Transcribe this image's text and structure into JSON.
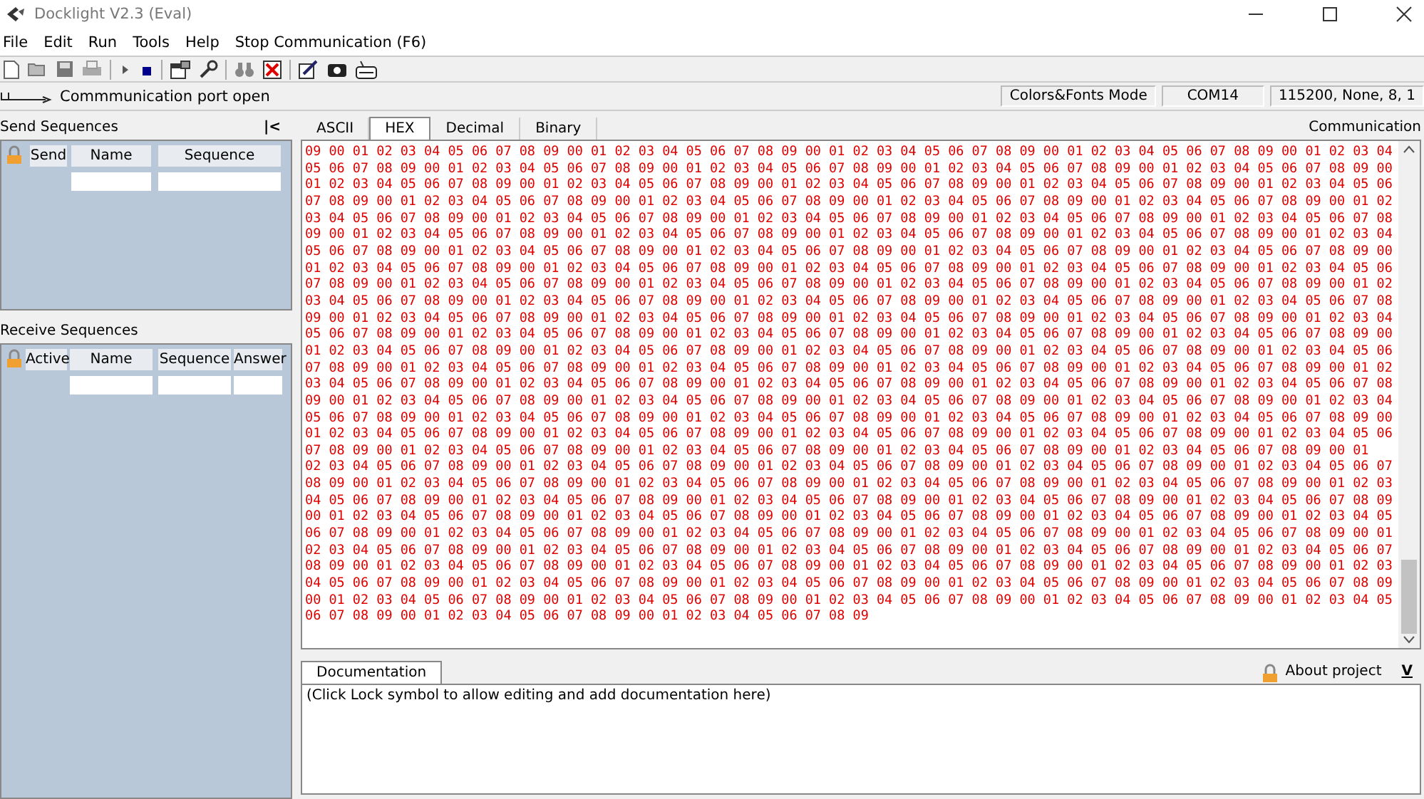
{
  "window": {
    "title": "Docklight V2.3 (Eval)"
  },
  "menu": [
    "File",
    "Edit",
    "Run",
    "Tools",
    "Help",
    "Stop Communication  (F6)"
  ],
  "status": {
    "port_message": "Commmunication port open",
    "mode": "Colors&Fonts Mode",
    "port": "COM14",
    "settings": "115200, None, 8, 1"
  },
  "send_sequences": {
    "title": "Send Sequences",
    "collapse": "|<",
    "columns": [
      "Send",
      "Name",
      "Sequence"
    ]
  },
  "receive_sequences": {
    "title": "Receive Sequences",
    "columns": [
      "Active",
      "Name",
      "Sequence",
      "Answer"
    ]
  },
  "communication": {
    "title": "Communication",
    "tabs": [
      {
        "label": "ASCII",
        "selected": false
      },
      {
        "label": "HEX",
        "selected": true
      },
      {
        "label": "Decimal",
        "selected": false
      },
      {
        "label": "Binary",
        "selected": false
      }
    ],
    "lines": [
      "09 00 01 02 03 04 05 06 07 08 09 00 01 02 03 04 05 06 07 08 09 00 01 02 03 04 05 06 07 08 09 00 01 02 03 04 05 06 07 08 09 00 01 02 03 04",
      "05 06 07 08 09 00 01 02 03 04 05 06 07 08 09 00 01 02 03 04 05 06 07 08 09 00 01 02 03 04 05 06 07 08 09 00 01 02 03 04 05 06 07 08 09 00",
      "01 02 03 04 05 06 07 08 09 00 01 02 03 04 05 06 07 08 09 00 01 02 03 04 05 06 07 08 09 00 01 02 03 04 05 06 07 08 09 00 01 02 03 04 05 06",
      "07 08 09 00 01 02 03 04 05 06 07 08 09 00 01 02 03 04 05 06 07 08 09 00 01 02 03 04 05 06 07 08 09 00 01 02 03 04 05 06 07 08 09 00 01 02",
      "03 04 05 06 07 08 09 00 01 02 03 04 05 06 07 08 09 00 01 02 03 04 05 06 07 08 09 00 01 02 03 04 05 06 07 08 09 00 01 02 03 04 05 06 07 08",
      "09 00 01 02 03 04 05 06 07 08 09 00 01 02 03 04 05 06 07 08 09 00 01 02 03 04 05 06 07 08 09 00 01 02 03 04 05 06 07 08 09 00 01 02 03 04",
      "05 06 07 08 09 00 01 02 03 04 05 06 07 08 09 00 01 02 03 04 05 06 07 08 09 00 01 02 03 04 05 06 07 08 09 00 01 02 03 04 05 06 07 08 09 00",
      "01 02 03 04 05 06 07 08 09 00 01 02 03 04 05 06 07 08 09 00 01 02 03 04 05 06 07 08 09 00 01 02 03 04 05 06 07 08 09 00 01 02 03 04 05 06",
      "07 08 09 00 01 02 03 04 05 06 07 08 09 00 01 02 03 04 05 06 07 08 09 00 01 02 03 04 05 06 07 08 09 00 01 02 03 04 05 06 07 08 09 00 01 02",
      "03 04 05 06 07 08 09 00 01 02 03 04 05 06 07 08 09 00 01 02 03 04 05 06 07 08 09 00 01 02 03 04 05 06 07 08 09 00 01 02 03 04 05 06 07 08",
      "09 00 01 02 03 04 05 06 07 08 09 00 01 02 03 04 05 06 07 08 09 00 01 02 03 04 05 06 07 08 09 00 01 02 03 04 05 06 07 08 09 00 01 02 03 04",
      "05 06 07 08 09 00 01 02 03 04 05 06 07 08 09 00 01 02 03 04 05 06 07 08 09 00 01 02 03 04 05 06 07 08 09 00 01 02 03 04 05 06 07 08 09 00",
      "01 02 03 04 05 06 07 08 09 00 01 02 03 04 05 06 07 08 09 00 01 02 03 04 05 06 07 08 09 00 01 02 03 04 05 06 07 08 09 00 01 02 03 04 05 06",
      "07 08 09 00 01 02 03 04 05 06 07 08 09 00 01 02 03 04 05 06 07 08 09 00 01 02 03 04 05 06 07 08 09 00 01 02 03 04 05 06 07 08 09 00 01 02",
      "03 04 05 06 07 08 09 00 01 02 03 04 05 06 07 08 09 00 01 02 03 04 05 06 07 08 09 00 01 02 03 04 05 06 07 08 09 00 01 02 03 04 05 06 07 08",
      "09 00 01 02 03 04 05 06 07 08 09 00 01 02 03 04 05 06 07 08 09 00 01 02 03 04 05 06 07 08 09 00 01 02 03 04 05 06 07 08 09 00 01 02 03 04",
      "05 06 07 08 09 00 01 02 03 04 05 06 07 08 09 00 01 02 03 04 05 06 07 08 09 00 01 02 03 04 05 06 07 08 09 00 01 02 03 04 05 06 07 08 09 00",
      "01 02 03 04 05 06 07 08 09 00 01 02 03 04 05 06 07 08 09 00 01 02 03 04 05 06 07 08 09 00 01 02 03 04 05 06 07 08 09 00 01 02 03 04 05 06",
      "07 08 09 00 01 02 03 04 05 06 07 08 09 00 01 02 03 04 05 06 07 08 09 00 01 02 03 04 05 06 07 08 09 00 01 02 03 04 05 06 07 08 09 00 01",
      "02 03 04 05 06 07 08 09 00 01 02 03 04 05 06 07 08 09 00 01 02 03 04 05 06 07 08 09 00 01 02 03 04 05 06 07 08 09 00 01 02 03 04 05 06 07",
      "08 09 00 01 02 03 04 05 06 07 08 09 00 01 02 03 04 05 06 07 08 09 00 01 02 03 04 05 06 07 08 09 00 01 02 03 04 05 06 07 08 09 00 01 02 03",
      "04 05 06 07 08 09 00 01 02 03 04 05 06 07 08 09 00 01 02 03 04 05 06 07 08 09 00 01 02 03 04 05 06 07 08 09 00 01 02 03 04 05 06 07 08 09",
      "00 01 02 03 04 05 06 07 08 09 00 01 02 03 04 05 06 07 08 09 00 01 02 03 04 05 06 07 08 09 00 01 02 03 04 05 06 07 08 09 00 01 02 03 04 05",
      "06 07 08 09 00 01 02 03 04 05 06 07 08 09 00 01 02 03 04 05 06 07 08 09 00 01 02 03 04 05 06 07 08 09 00 01 02 03 04 05 06 07 08 09 00 01",
      "02 03 04 05 06 07 08 09 00 01 02 03 04 05 06 07 08 09 00 01 02 03 04 05 06 07 08 09 00 01 02 03 04 05 06 07 08 09 00 01 02 03 04 05 06 07",
      "08 09 00 01 02 03 04 05 06 07 08 09 00 01 02 03 04 05 06 07 08 09 00 01 02 03 04 05 06 07 08 09 00 01 02 03 04 05 06 07 08 09 00 01 02 03",
      "04 05 06 07 08 09 00 01 02 03 04 05 06 07 08 09 00 01 02 03 04 05 06 07 08 09 00 01 02 03 04 05 06 07 08 09 00 01 02 03 04 05 06 07 08 09",
      "00 01 02 03 04 05 06 07 08 09 00 01 02 03 04 05 06 07 08 09 00 01 02 03 04 05 06 07 08 09 00 01 02 03 04 05 06 07 08 09 00 01 02 03 04 05",
      "06 07 08 09 00 01 02 03 04 05 06 07 08 09 00 01 02 03 04 05 06 07 08 09"
    ]
  },
  "documentation": {
    "tab": "Documentation",
    "about": "About project",
    "toggle": "V",
    "text": "(Click Lock symbol to allow editing and add documentation here)"
  }
}
